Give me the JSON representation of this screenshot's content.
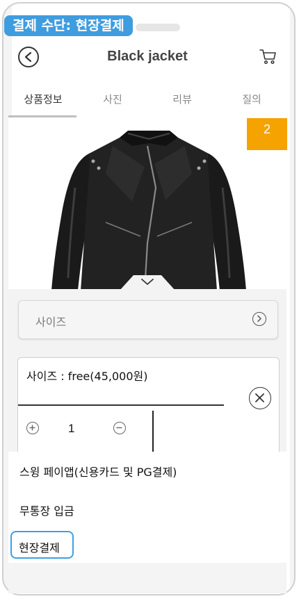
{
  "caption": "결제 수단: 현장결제",
  "header": {
    "title": "Black jacket"
  },
  "tabs": [
    {
      "label": "상품정보",
      "active": true
    },
    {
      "label": "사진",
      "active": false
    },
    {
      "label": "리뷰",
      "active": false
    },
    {
      "label": "질의",
      "active": false
    }
  ],
  "gallery": {
    "image_count": "2",
    "badge_color": "#f5a300"
  },
  "options": {
    "size_label": "사이즈",
    "selected_text": "사이즈 : free(45,000원)",
    "quantity": "1"
  },
  "payment": {
    "methods": [
      "스윙 페이앱(신용카드 및 PG결제)",
      "무통장 입금",
      "현장결제"
    ],
    "selected": "현장결제",
    "accent": "#3aa0e6"
  }
}
